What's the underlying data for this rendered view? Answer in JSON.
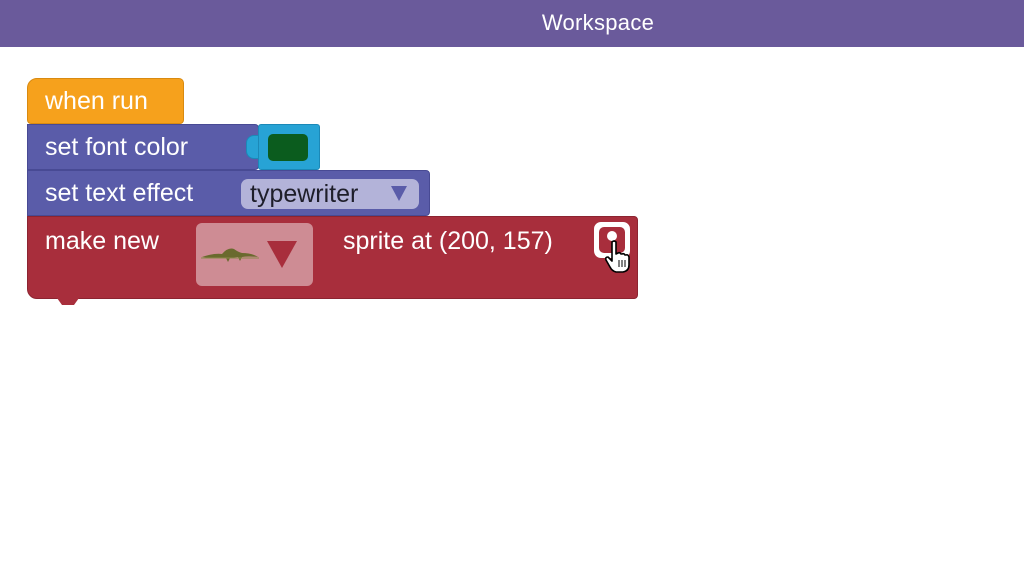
{
  "header": {
    "title": "Workspace"
  },
  "blocks": {
    "when_run": {
      "label": "when run",
      "color": "#f6a11c"
    },
    "set_font_color": {
      "label": "set font color",
      "value_color": "#0b5c1e",
      "color": "#5a5ca9"
    },
    "set_text_effect": {
      "label": "set text effect",
      "dropdown_value": "typewriter",
      "color": "#5a5ca9"
    },
    "make_new_sprite": {
      "label_prefix": "make new",
      "label_suffix": "sprite at (200, 157)",
      "costume_icon": "dinosaur-icon",
      "color": "#a82e3c"
    }
  },
  "colors": {
    "header_bg": "#6a5a9b",
    "color_socket": "#27a3d5"
  },
  "icons": {
    "location": "location-pin-icon",
    "cursor": "hand-cursor-icon"
  }
}
